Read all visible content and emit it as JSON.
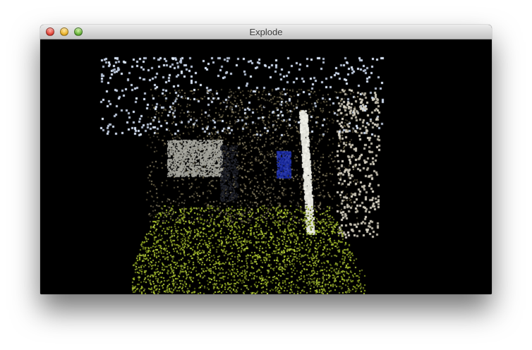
{
  "window": {
    "title": "Explode",
    "controls": [
      {
        "name": "close",
        "color": "#e2463b"
      },
      {
        "name": "minimize",
        "color": "#e9b22b"
      },
      {
        "name": "zoom",
        "color": "#68b33a"
      }
    ]
  },
  "viewport": {
    "content": "point-cloud",
    "background": "#000000",
    "palette": {
      "grass": "#a8c030",
      "sky": "#c8d4e8",
      "foliage": "#8a8060",
      "sign": "#a0a098",
      "blue_panel": "#2030a0",
      "pole": "#e8e8e0"
    }
  }
}
